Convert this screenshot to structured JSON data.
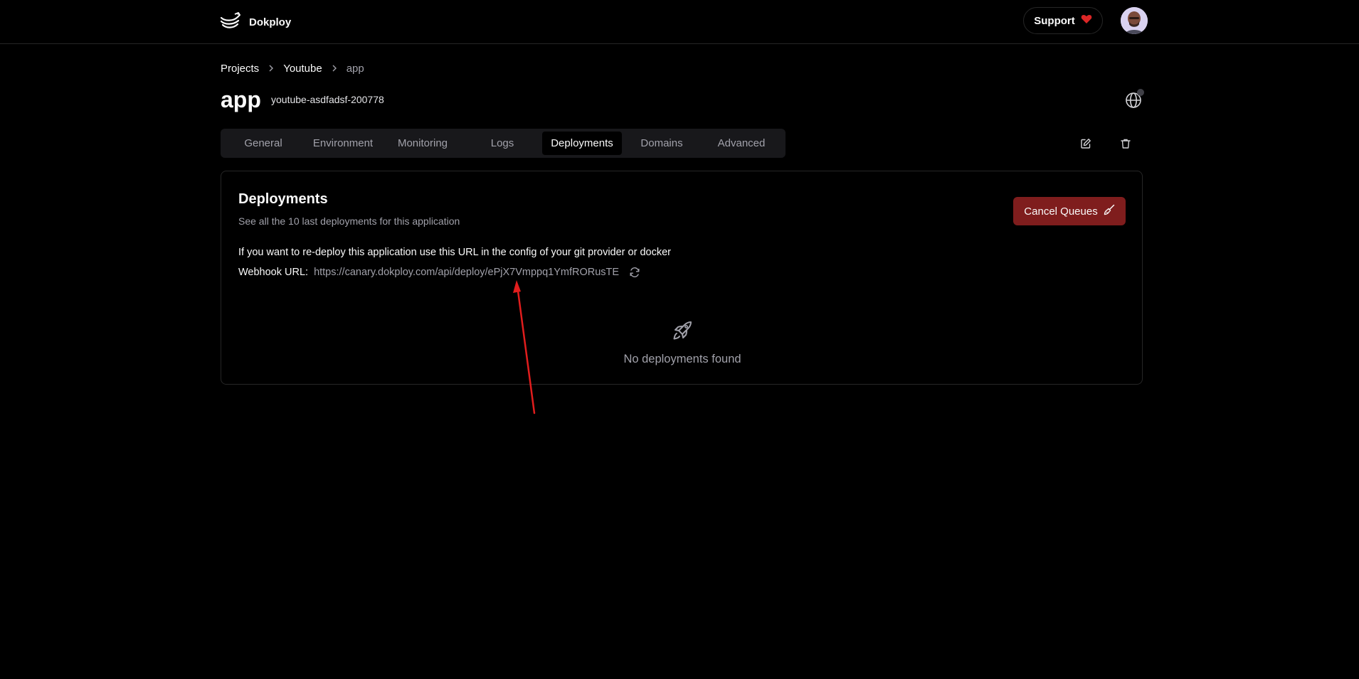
{
  "brand": {
    "name": "Dokploy"
  },
  "header": {
    "support_label": "Support",
    "icons": {
      "logo": "dokploy-logo-icon",
      "heart": "heart-icon",
      "avatar": "user-avatar"
    }
  },
  "breadcrumb": [
    {
      "label": "Projects"
    },
    {
      "label": "Youtube"
    },
    {
      "label": "app"
    }
  ],
  "page": {
    "title": "app",
    "app_name": "youtube-asdfadsf-200778"
  },
  "tabs": [
    {
      "label": "General"
    },
    {
      "label": "Environment"
    },
    {
      "label": "Monitoring"
    },
    {
      "label": "Logs"
    },
    {
      "label": "Deployments",
      "active": true
    },
    {
      "label": "Domains"
    },
    {
      "label": "Advanced"
    }
  ],
  "deployments": {
    "title": "Deployments",
    "description": "See all the 10 last deployments for this application",
    "cancel_label": "Cancel Queues",
    "redeploy_text": "If you want to re-deploy this application use this URL in the config of your git provider or docker",
    "webhook_label": "Webhook URL:",
    "webhook_url": "https://canary.dokploy.com/api/deploy/ePjX7Vmppq1YmfRORusTE",
    "empty_text": "No deployments found"
  },
  "colors": {
    "background": "#000000",
    "accent_destructive": "#7f1d1d",
    "annotation_arrow": "#e11d1d",
    "heart": "#dc2626"
  }
}
